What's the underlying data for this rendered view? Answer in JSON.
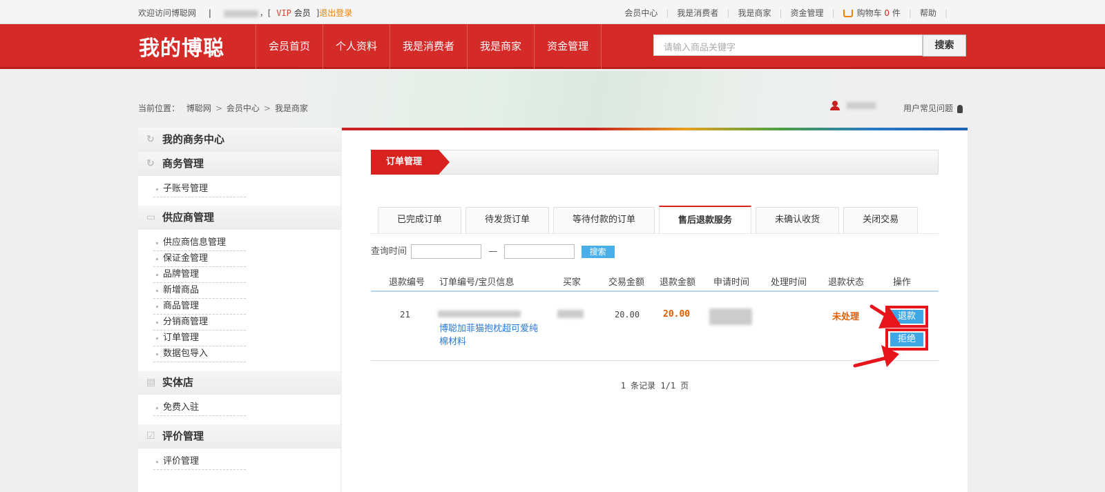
{
  "topbar": {
    "welcome": "欢迎访问博聪网",
    "divider": "|",
    "bracket_open": "，[",
    "vip": "VIP",
    "member": "会员",
    "bracket_close": "]",
    "logout": "退出登录",
    "links": [
      "会员中心",
      "我是消费者",
      "我是商家",
      "资金管理"
    ],
    "cart_label": "购物车",
    "cart_count": "0",
    "cart_unit": "件",
    "help": "帮助"
  },
  "header": {
    "logo": "我的博聪",
    "nav": [
      "会员首页",
      "个人资料",
      "我是消费者",
      "我是商家",
      "资金管理"
    ],
    "search_placeholder": "请输入商品关键字",
    "search_button": "搜索"
  },
  "breadcrumb": {
    "prefix": "当前位置：",
    "items": [
      "博聪网",
      "会员中心",
      "我是商家"
    ],
    "faq": "用户常见问题"
  },
  "sidebar": {
    "sections": [
      {
        "title": "我的商务中心",
        "icon": "refresh-icon",
        "items": []
      },
      {
        "title": "商务管理",
        "icon": "refresh-icon",
        "items": [
          "子账号管理"
        ]
      },
      {
        "title": "供应商管理",
        "icon": "card-icon",
        "items": [
          "供应商信息管理",
          "保证金管理",
          "品牌管理",
          "新增商品",
          "商品管理",
          "分销商管理",
          "订单管理",
          "数据包导入"
        ]
      },
      {
        "title": "实体店",
        "icon": "store-icon",
        "items": [
          "免费入驻"
        ]
      },
      {
        "title": "评价管理",
        "icon": "check-icon",
        "items": [
          "评价管理"
        ]
      }
    ]
  },
  "main": {
    "section_title": "订单管理",
    "tabs": [
      "已完成订单",
      "待发货订单",
      "等待付款的订单",
      "售后退款服务",
      "未确认收货",
      "关闭交易"
    ],
    "active_tab": "售后退款服务",
    "query_label": "查询时间",
    "query_dash": "—",
    "query_button": "搜索",
    "columns": [
      "退款编号",
      "订单编号/宝贝信息",
      "买家",
      "交易金额",
      "退款金额",
      "申请时间",
      "处理时间",
      "退款状态",
      "操作"
    ],
    "rows": [
      {
        "refund_id": "21",
        "goods_name": "博聪加菲猫抱枕超可爱纯棉材料",
        "trade_amount": "20.00",
        "refund_amount": "20.00",
        "status": "未处理",
        "action_refund": "退款",
        "action_reject": "拒绝"
      }
    ],
    "pager": "1 条记录 1/1 页"
  },
  "colors": {
    "brand_red": "#d42a28",
    "button_blue": "#3fa7e6",
    "status_orange": "#e35b00",
    "annotation_red": "#e8141c"
  }
}
